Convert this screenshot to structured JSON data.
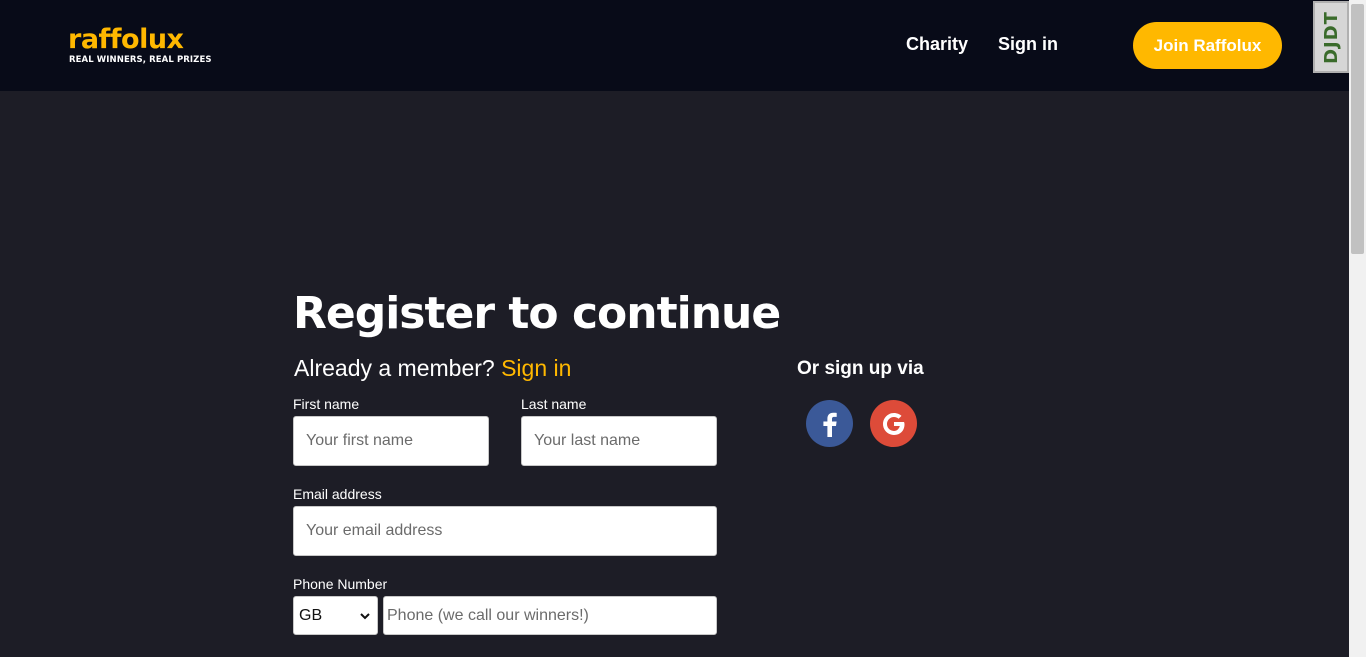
{
  "header": {
    "logo_text": "raffolux",
    "logo_tagline": "REAL WINNERS, REAL PRIZES",
    "nav": {
      "charity": "Charity",
      "sign_in": "Sign in"
    },
    "join_button": "Join Raffolux",
    "debug_toolbar": "DJDT"
  },
  "main": {
    "title": "Register to continue",
    "already_member": "Already a member?",
    "sign_in_link": "Sign in",
    "form": {
      "first_name": {
        "label": "First name",
        "placeholder": "Your first name",
        "value": ""
      },
      "last_name": {
        "label": "Last name",
        "placeholder": "Your last name",
        "value": ""
      },
      "email": {
        "label": "Email address",
        "placeholder": "Your email address",
        "value": ""
      },
      "phone": {
        "label": "Phone Number",
        "country": "GB",
        "placeholder": "Phone (we call our winners!)",
        "value": ""
      }
    },
    "social": {
      "heading": "Or sign up via",
      "facebook_icon": "facebook-icon",
      "google_icon": "google-icon"
    }
  },
  "colors": {
    "brand": "#ffb800",
    "header_bg": "#080b18",
    "page_bg": "#1d1d26",
    "facebook": "#3b5998",
    "google": "#dd4b39"
  }
}
